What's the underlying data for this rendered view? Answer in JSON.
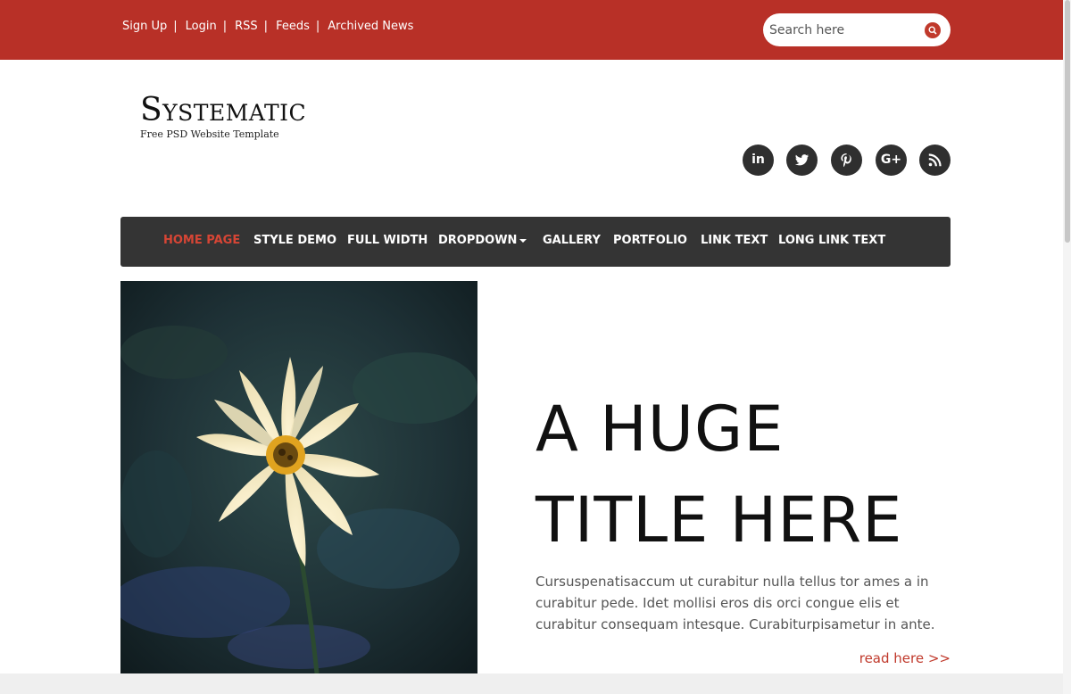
{
  "topbar": {
    "links": [
      "Sign Up",
      "Login",
      "RSS",
      "Feeds",
      "Archived News"
    ],
    "separator": "|",
    "search_placeholder": "Search here",
    "bg_color": "#b83027"
  },
  "logo": {
    "title": "Systematic",
    "tagline": "Free PSD Website Template"
  },
  "social": [
    "linkedin-icon",
    "twitter-icon",
    "pinterest-icon",
    "google-plus-icon",
    "rss-icon"
  ],
  "nav": {
    "items": [
      "HOME PAGE",
      "STYLE DEMO",
      "FULL WIDTH",
      "DROPDOWN",
      "GALLERY",
      "PORTFOLIO",
      "LINK TEXT",
      "LONG LINK TEXT"
    ],
    "active_index": 0,
    "active_color": "#d64535"
  },
  "hero": {
    "title_line1": "A HUGE",
    "title_line2": "TITLE HERE",
    "body": "Cursuspenatisaccum ut curabitur nulla tellus tor ames a in curabitur pede. Idet mollisi eros dis orci congue elis et curabitur consequam intesque. Curabiturpisametur in ante.",
    "read_more": "read here >>"
  }
}
